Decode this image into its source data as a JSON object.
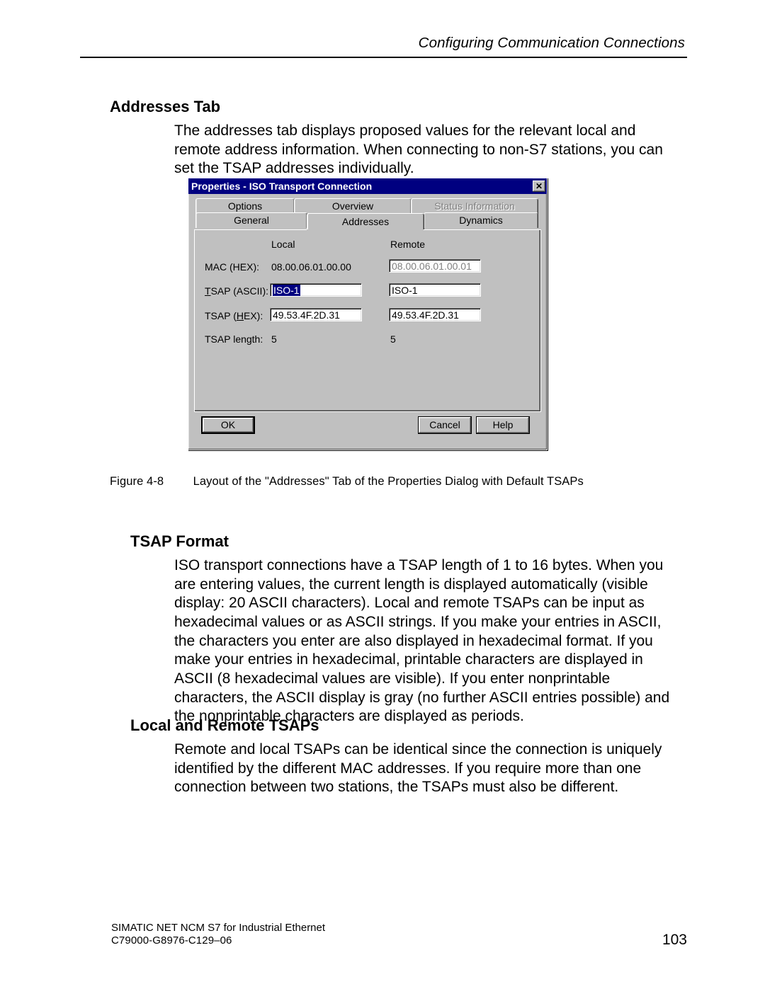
{
  "header": {
    "running_head": "Configuring Communication Connections"
  },
  "section_addresses": {
    "heading": "Addresses Tab",
    "body": "The addresses tab displays proposed values for the relevant local and remote address information. When connecting to non-S7 stations, you can set the TSAP addresses individually."
  },
  "figure": {
    "label": "Figure 4-8",
    "caption": "Layout of the \"Addresses\" Tab of the Properties Dialog with Default TSAPs"
  },
  "section_tsap": {
    "heading": "TSAP Format",
    "body": "ISO transport connections have a TSAP length of 1 to 16 bytes. When you are entering values, the current length is displayed automatically (visible display: 20 ASCII characters). Local and remote TSAPs can be input as hexadecimal values or as ASCII strings. If you make your entries in ASCII, the characters you enter are also displayed in hexadecimal format. If you make your entries in hexadecimal, printable characters are displayed in ASCII (8 hexadecimal values are visible). If you enter nonprintable characters, the ASCII display is gray (no further ASCII entries possible) and the nonprintable characters are displayed as periods."
  },
  "section_lr": {
    "heading": "Local and Remote TSAPs",
    "body": "Remote and local TSAPs can be identical since the connection is uniquely identified by the different MAC addresses. If you require more than one connection between two stations, the TSAPs must also be different."
  },
  "dialog": {
    "title": "Properties - ISO Transport Connection",
    "tabs_back": [
      "Options",
      "Overview",
      "Status Information"
    ],
    "tabs_front": [
      "General",
      "Addresses",
      "Dynamics"
    ],
    "active_tab": "Addresses",
    "col_local": "Local",
    "col_remote": "Remote",
    "rows": {
      "mac": "MAC  (HEX):",
      "tsap_asc_pre": "T",
      "tsap_asc_post": "SAP (ASCII):",
      "tsap_hex_pre": "TSAP (",
      "tsap_hex_mid": "H",
      "tsap_hex_post": "EX):",
      "tsap_len": "TSAP length:"
    },
    "values": {
      "local_mac": "08.00.06.01.00.00",
      "remote_mac": "08.00.06.01.00.01",
      "local_ascii": "ISO-1",
      "remote_ascii": "ISO-1",
      "local_hex": "49.53.4F.2D.31",
      "remote_hex": "49.53.4F.2D.31",
      "local_len": "5",
      "remote_len": "5"
    },
    "buttons": {
      "ok": "OK",
      "cancel": "Cancel",
      "help": "Help"
    }
  },
  "footer": {
    "line1": "SIMATIC NET NCM S7 for Industrial Ethernet",
    "line2": "C79000-G8976-C129–06",
    "page": "103"
  }
}
